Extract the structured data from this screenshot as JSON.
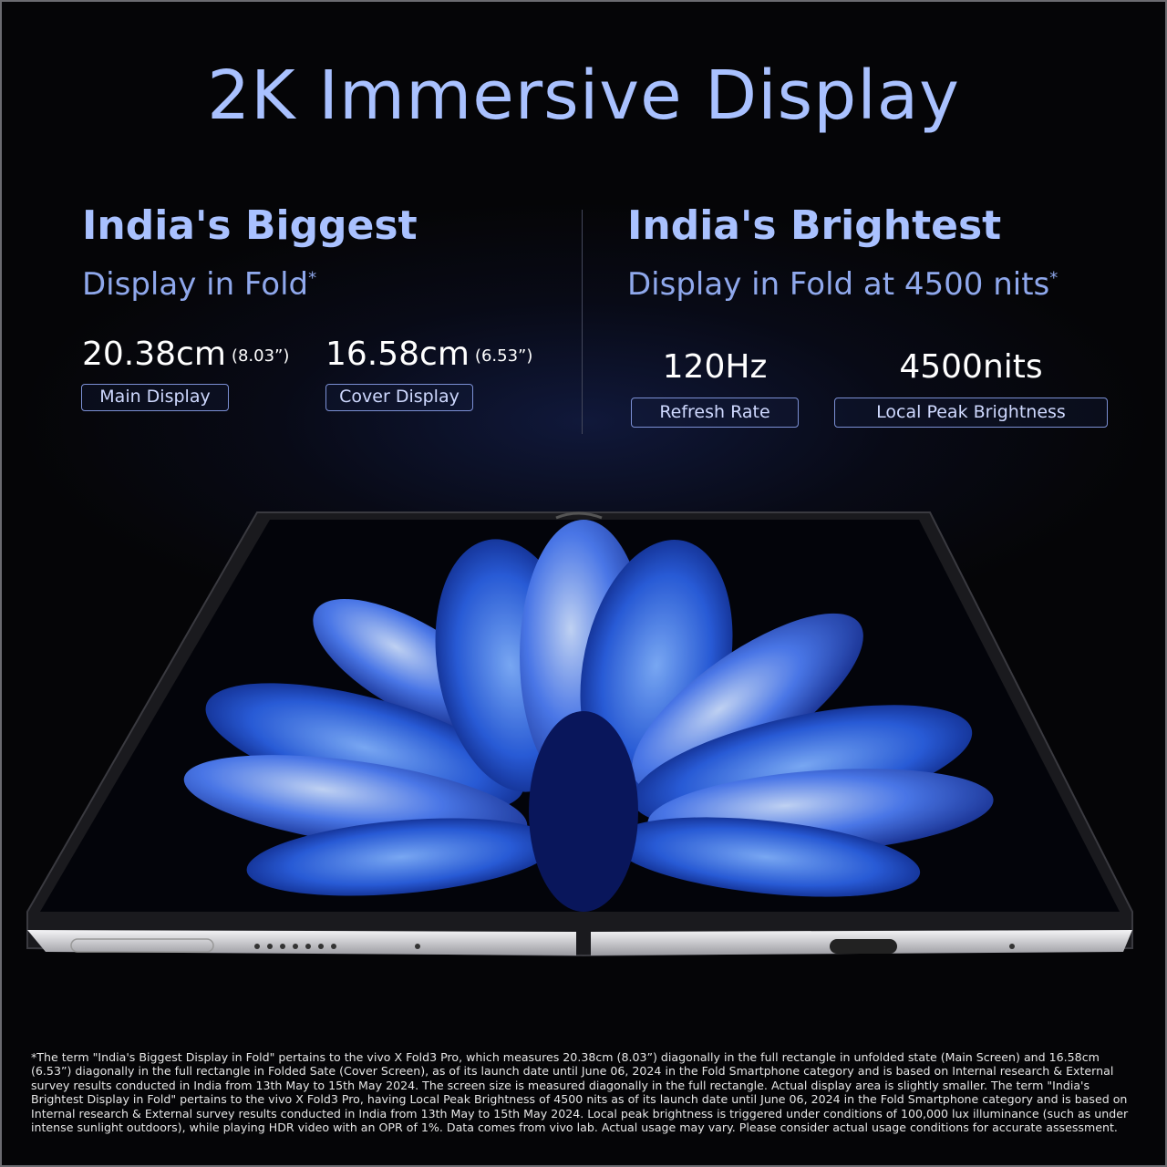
{
  "headline": "2K Immersive Display",
  "left": {
    "title": "India's Biggest",
    "subtitle": "Display in Fold",
    "subtitle_mark": "*",
    "stats": [
      {
        "value": "20.38cm",
        "inches": "(8.03”)",
        "label": "Main Display"
      },
      {
        "value": "16.58cm",
        "inches": "(6.53”)",
        "label": "Cover Display"
      }
    ]
  },
  "right": {
    "title": "India's Brightest",
    "subtitle": "Display in Fold at 4500 nits",
    "subtitle_mark": "*",
    "stats": [
      {
        "value": "120Hz",
        "label": "Refresh Rate"
      },
      {
        "value": "4500nits",
        "label": "Local Peak Brightness"
      }
    ]
  },
  "colors": {
    "headline": "#a9c1ff",
    "accent": "#8fa8ec",
    "background": "#050507"
  },
  "footnote": "*The term \"India's Biggest Display in Fold\" pertains to the vivo X Fold3 Pro, which measures 20.38cm (8.03”) diagonally in the full rectangle in unfolded state (Main Screen) and 16.58cm (6.53”) diagonally in the full rectangle in Folded Sate (Cover Screen), as of its launch date until June 06, 2024 in the Fold Smartphone category and is based on Internal research & External survey results conducted in India from 13th May to 15th May 2024. The screen size is measured diagonally in the full rectangle. Actual display area is slightly smaller. The term \"India's Brightest Display in Fold\" pertains to the vivo X Fold3 Pro, having Local Peak Brightness of 4500 nits as of its launch date until June 06, 2024 in the Fold Smartphone category and is based on Internal research & External survey results conducted in India from 13th May to 15th May 2024. Local peak brightness is triggered under conditions of 100,000 lux illuminance (such as under intense sunlight outdoors), while playing HDR video with an OPR of 1%. Data comes from vivo lab. Actual usage may vary. Please consider actual usage conditions for accurate assessment."
}
